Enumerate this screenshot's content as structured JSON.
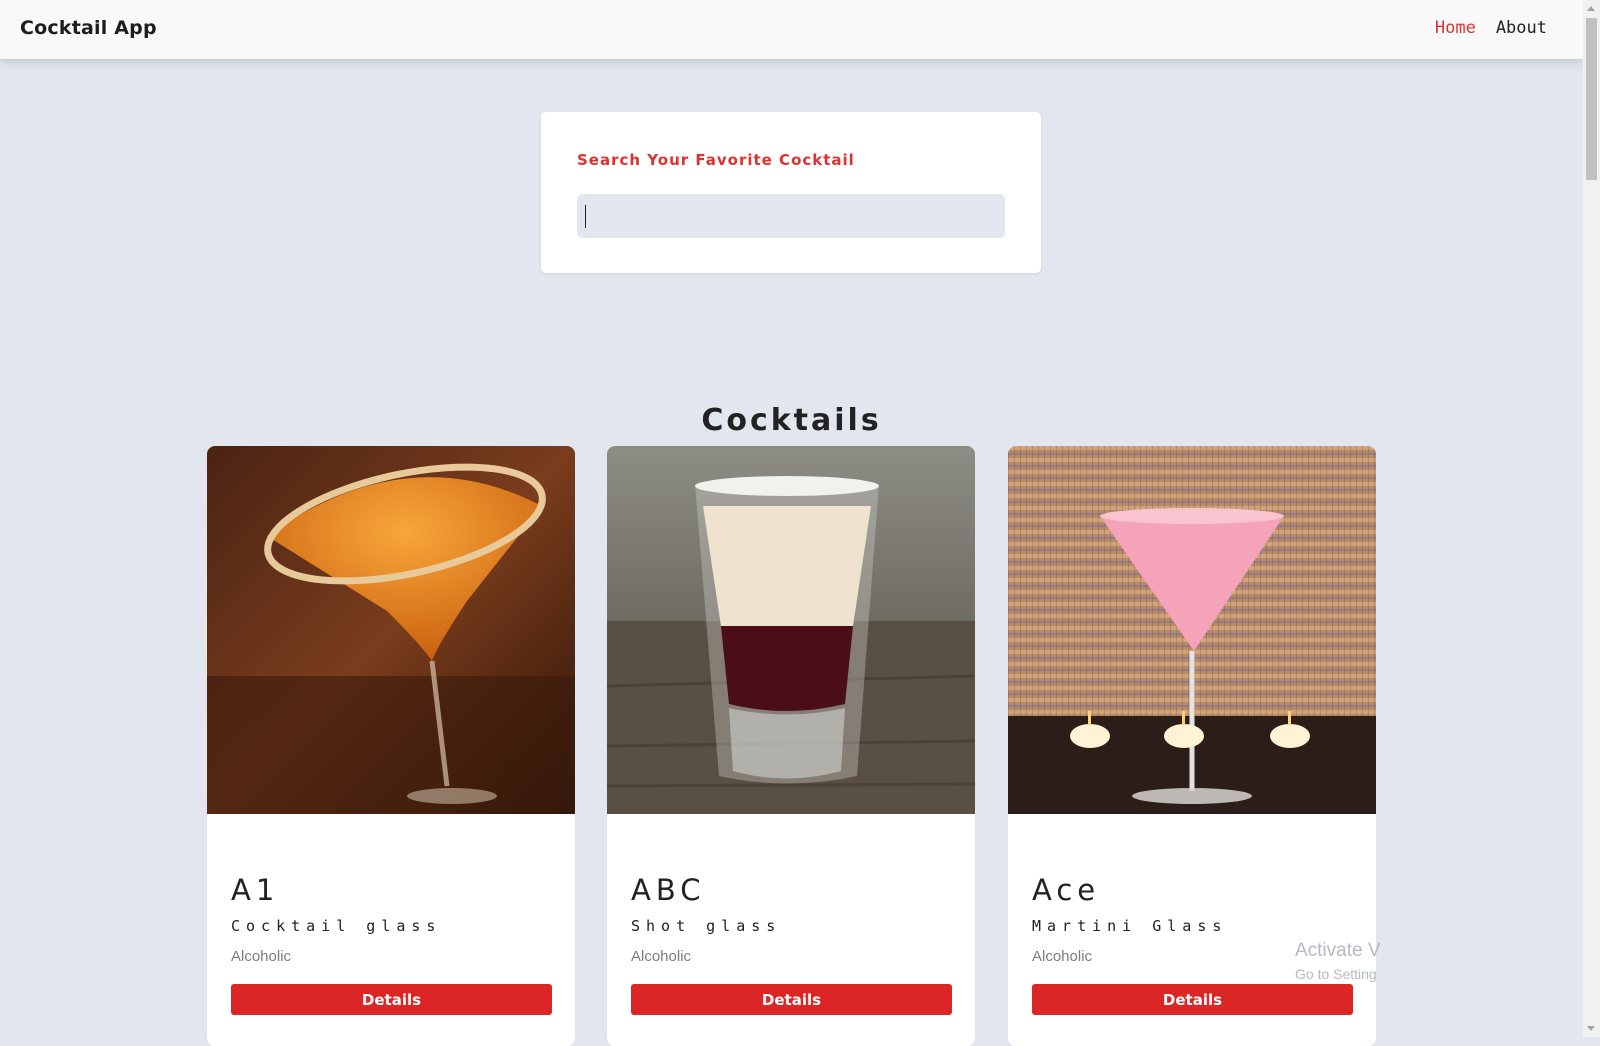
{
  "navbar": {
    "brand": "Cocktail App",
    "links": [
      {
        "label": "Home",
        "active": true
      },
      {
        "label": "About",
        "active": false
      }
    ],
    "active_color": "#e03131"
  },
  "search": {
    "label": "Search Your Favorite Cocktail",
    "value": "",
    "placeholder": ""
  },
  "main": {
    "section_title": "Cocktails",
    "cocktails": [
      {
        "name": "A1",
        "glass": "Cocktail glass",
        "type": "Alcoholic",
        "button_label": "Details",
        "image_icon": "orange-martini-photo"
      },
      {
        "name": "ABC",
        "glass": "Shot glass",
        "type": "Alcoholic",
        "button_label": "Details",
        "image_icon": "layered-shot-photo"
      },
      {
        "name": "Ace",
        "glass": "Martini Glass",
        "type": "Alcoholic",
        "button_label": "Details",
        "image_icon": "pink-martini-photo"
      }
    ],
    "button_color": "#dc2626"
  },
  "watermark": {
    "title": "Activate V",
    "subtitle": "Go to Setting"
  }
}
